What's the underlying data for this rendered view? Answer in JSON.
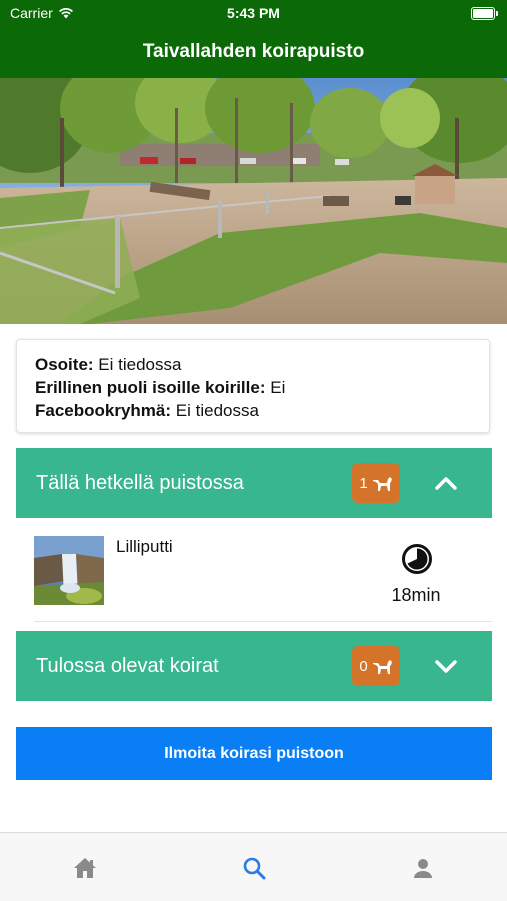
{
  "status_bar": {
    "carrier": "Carrier",
    "time": "5:43 PM"
  },
  "nav": {
    "title": "Taivallahden koirapuisto"
  },
  "info": {
    "address_label": "Osoite:",
    "address_value": "Ei tiedossa",
    "separate_label": "Erillinen puoli isoille koirille:",
    "separate_value": "Ei",
    "facebook_label": "Facebookryhmä:",
    "facebook_value": "Ei tiedossa"
  },
  "in_park": {
    "title": "Tällä hetkellä puistossa",
    "count": "1",
    "dogs": [
      {
        "name": "Lilliputti",
        "duration": "18min"
      }
    ]
  },
  "upcoming": {
    "title": "Tulossa olevat koirat",
    "count": "0"
  },
  "cta": {
    "label": "Ilmoita koirasi puistoon"
  },
  "colors": {
    "header": "#0b6a07",
    "accordion": "#38b68e",
    "badge": "#d4742b",
    "cta": "#0a7ff5",
    "tab_active": "#2a7be4"
  },
  "tabs": [
    {
      "icon": "home-icon",
      "active": false
    },
    {
      "icon": "search-icon",
      "active": true
    },
    {
      "icon": "person-icon",
      "active": false
    }
  ]
}
